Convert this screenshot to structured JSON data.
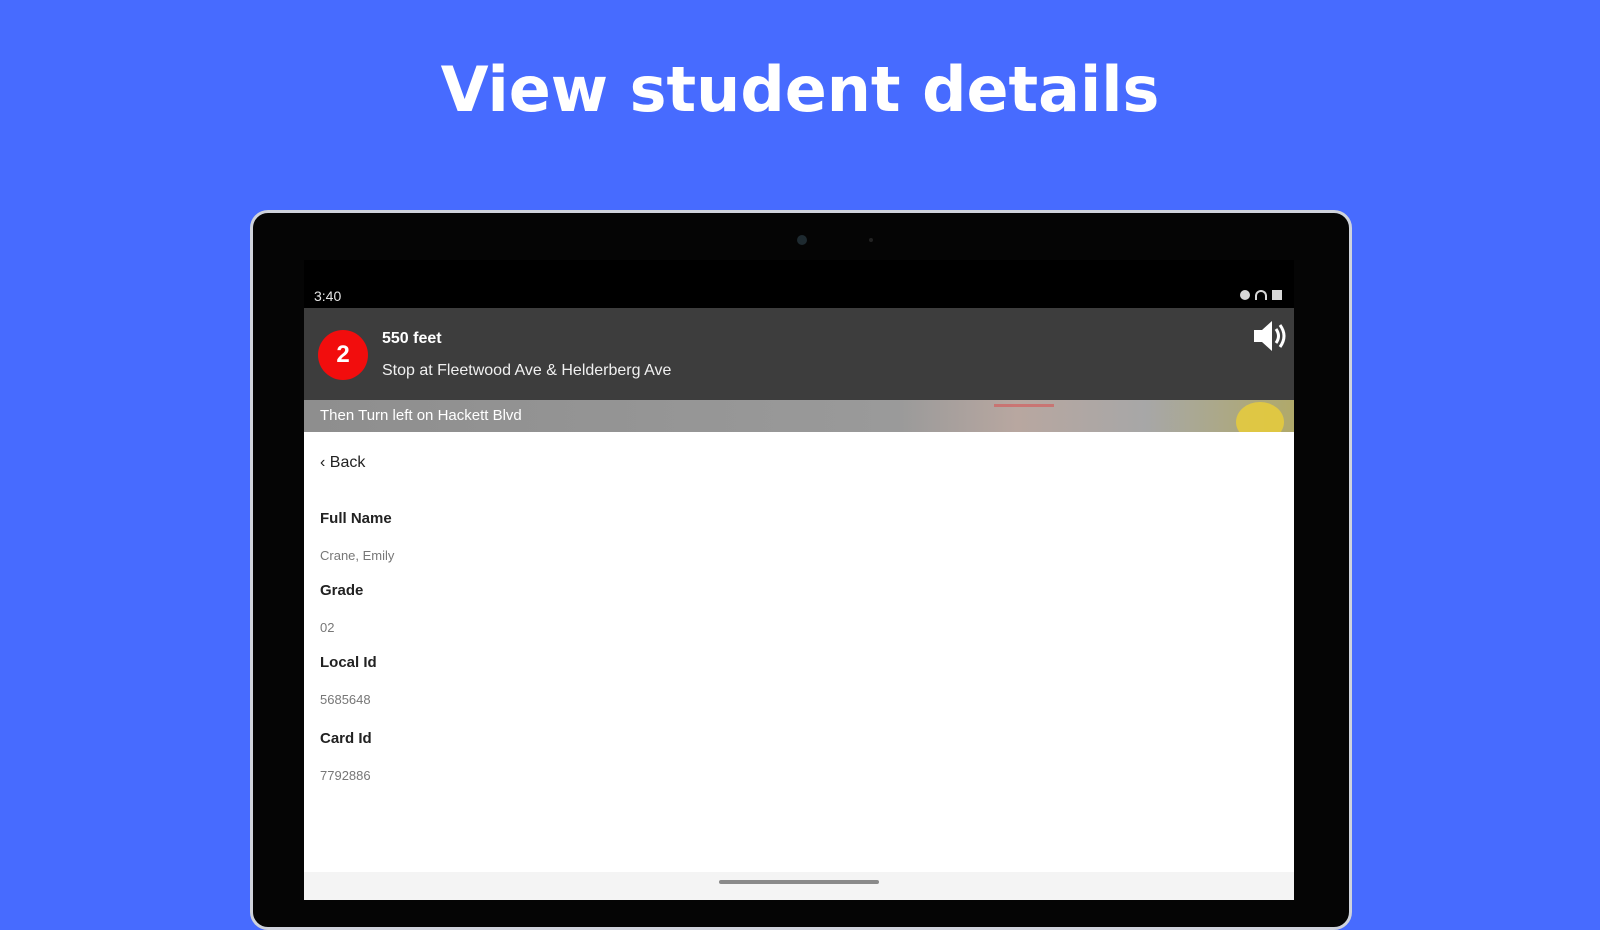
{
  "headline": "View student details",
  "status_bar": {
    "time": "3:40",
    "icons": [
      "location-icon",
      "wifi-icon",
      "battery-icon"
    ]
  },
  "navigation": {
    "maneuver_number": "2",
    "distance": "550 feet",
    "instruction": "Stop at Fleetwood Ave & Helderberg Ave",
    "next_instruction": "Then Turn left on Hackett Blvd",
    "speaker_icon": "speaker-icon",
    "badge_color": "#f20d0d"
  },
  "back_label": "‹ Back",
  "fields": [
    {
      "label": "Full Name",
      "value": "Crane, Emily"
    },
    {
      "label": "Grade",
      "value": "02"
    },
    {
      "label": "Local Id",
      "value": "5685648"
    },
    {
      "label": "Card Id",
      "value": "7792886"
    }
  ],
  "colors": {
    "background": "#476bff",
    "nav_bar": "#3d3d3d",
    "accent": "#f20d0d"
  }
}
